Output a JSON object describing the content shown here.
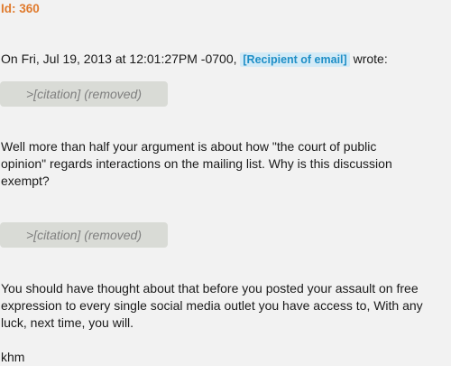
{
  "email": {
    "id_label": "Id: 360",
    "header": {
      "prefix": "On Fri, Jul 19, 2013 at 12:01:27PM -0700,",
      "recipient": "[Recipient of email]",
      "suffix": "wrote:"
    },
    "citation_1": ">[citation] (removed)",
    "paragraph_1": "Well more than half your argument is about how \"the court of public opinion\" regards interactions on the mailing list. Why is this discussion exempt?",
    "citation_2": ">[citation] (removed)",
    "paragraph_2": "You should have thought about that before you posted your assault on free expression to every single social media outlet you have access to, With any luck, next time, you will.",
    "signature": "khm"
  },
  "colors": {
    "id_label": "#e07b2e",
    "recipient_text": "#1f8fc7",
    "recipient_bg": "#d3eaf6",
    "citation_bg": "#d9dbd6",
    "citation_text": "#7f7f7f",
    "background": "#f2f2f2"
  }
}
